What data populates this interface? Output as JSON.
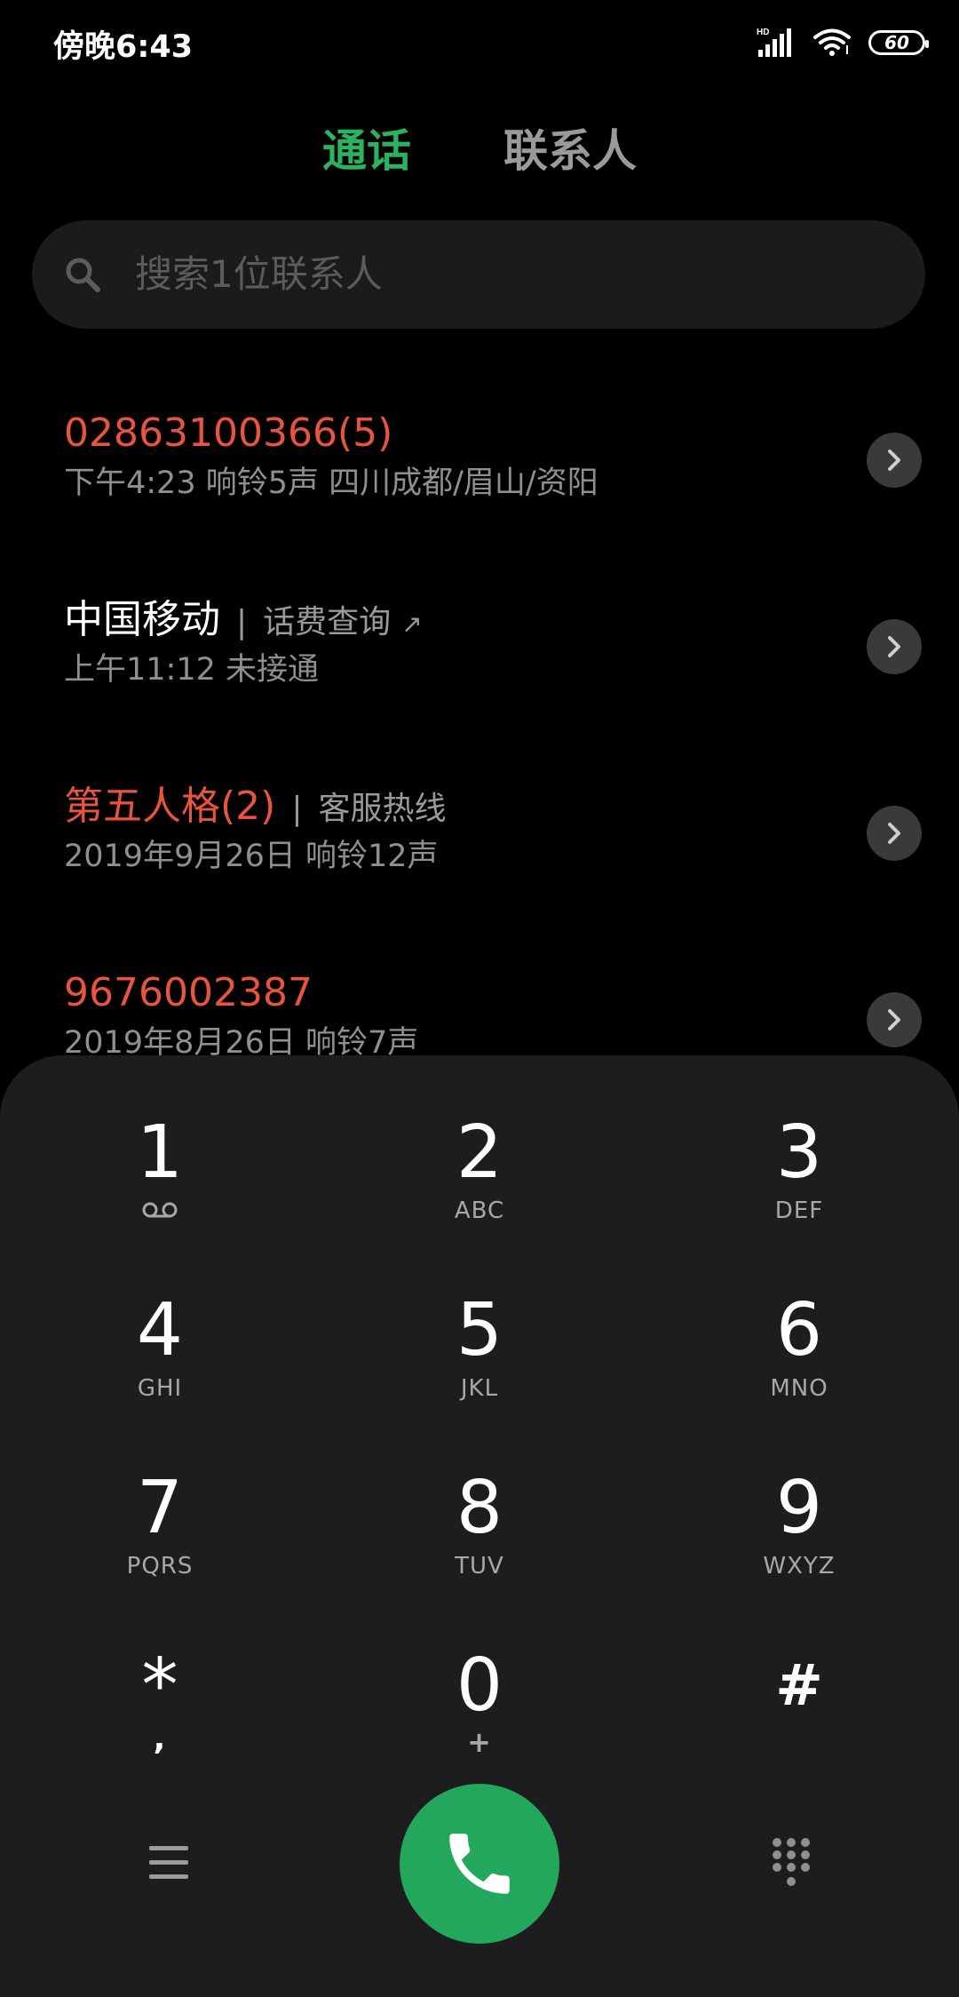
{
  "status_bar": {
    "time": "傍晚6:43",
    "network": "HD",
    "battery": "60"
  },
  "tabs": [
    {
      "label": "通话",
      "active": true
    },
    {
      "label": "联系人",
      "active": false
    }
  ],
  "search": {
    "placeholder": "搜索1位联系人"
  },
  "calls": [
    {
      "name": "02863100366(5)",
      "missed": true,
      "tag": "",
      "detail": "下午4:23 响铃5声  四川成都/眉山/资阳"
    },
    {
      "name": "中国移动",
      "missed": false,
      "tag": "话费查询",
      "detail": "上午11:12 未接通"
    },
    {
      "name": "第五人格(2)",
      "missed": true,
      "tag": "客服热线",
      "detail": "2019年9月26日 响铃12声"
    },
    {
      "name": "9676002387",
      "missed": true,
      "tag": "",
      "detail": "2019年8月26日 响铃7声"
    }
  ],
  "dialpad": {
    "keys": [
      {
        "digit": "1",
        "letters": ""
      },
      {
        "digit": "2",
        "letters": "ABC"
      },
      {
        "digit": "3",
        "letters": "DEF"
      },
      {
        "digit": "4",
        "letters": "GHI"
      },
      {
        "digit": "5",
        "letters": "JKL"
      },
      {
        "digit": "6",
        "letters": "MNO"
      },
      {
        "digit": "7",
        "letters": "PQRS"
      },
      {
        "digit": "8",
        "letters": "TUV"
      },
      {
        "digit": "9",
        "letters": "WXYZ"
      },
      {
        "digit": "*",
        "letters": ","
      },
      {
        "digit": "0",
        "letters": "+"
      },
      {
        "digit": "#",
        "letters": ""
      }
    ]
  },
  "colors": {
    "accent": "#2bb160",
    "missed": "#e8543f",
    "call_button": "#23a75c"
  },
  "icons": {
    "search": "search-icon",
    "chevron": "chevron-right-icon",
    "voicemail": "voicemail-icon",
    "menu": "menu-icon",
    "call": "phone-icon",
    "keypad": "dialpad-icon"
  }
}
